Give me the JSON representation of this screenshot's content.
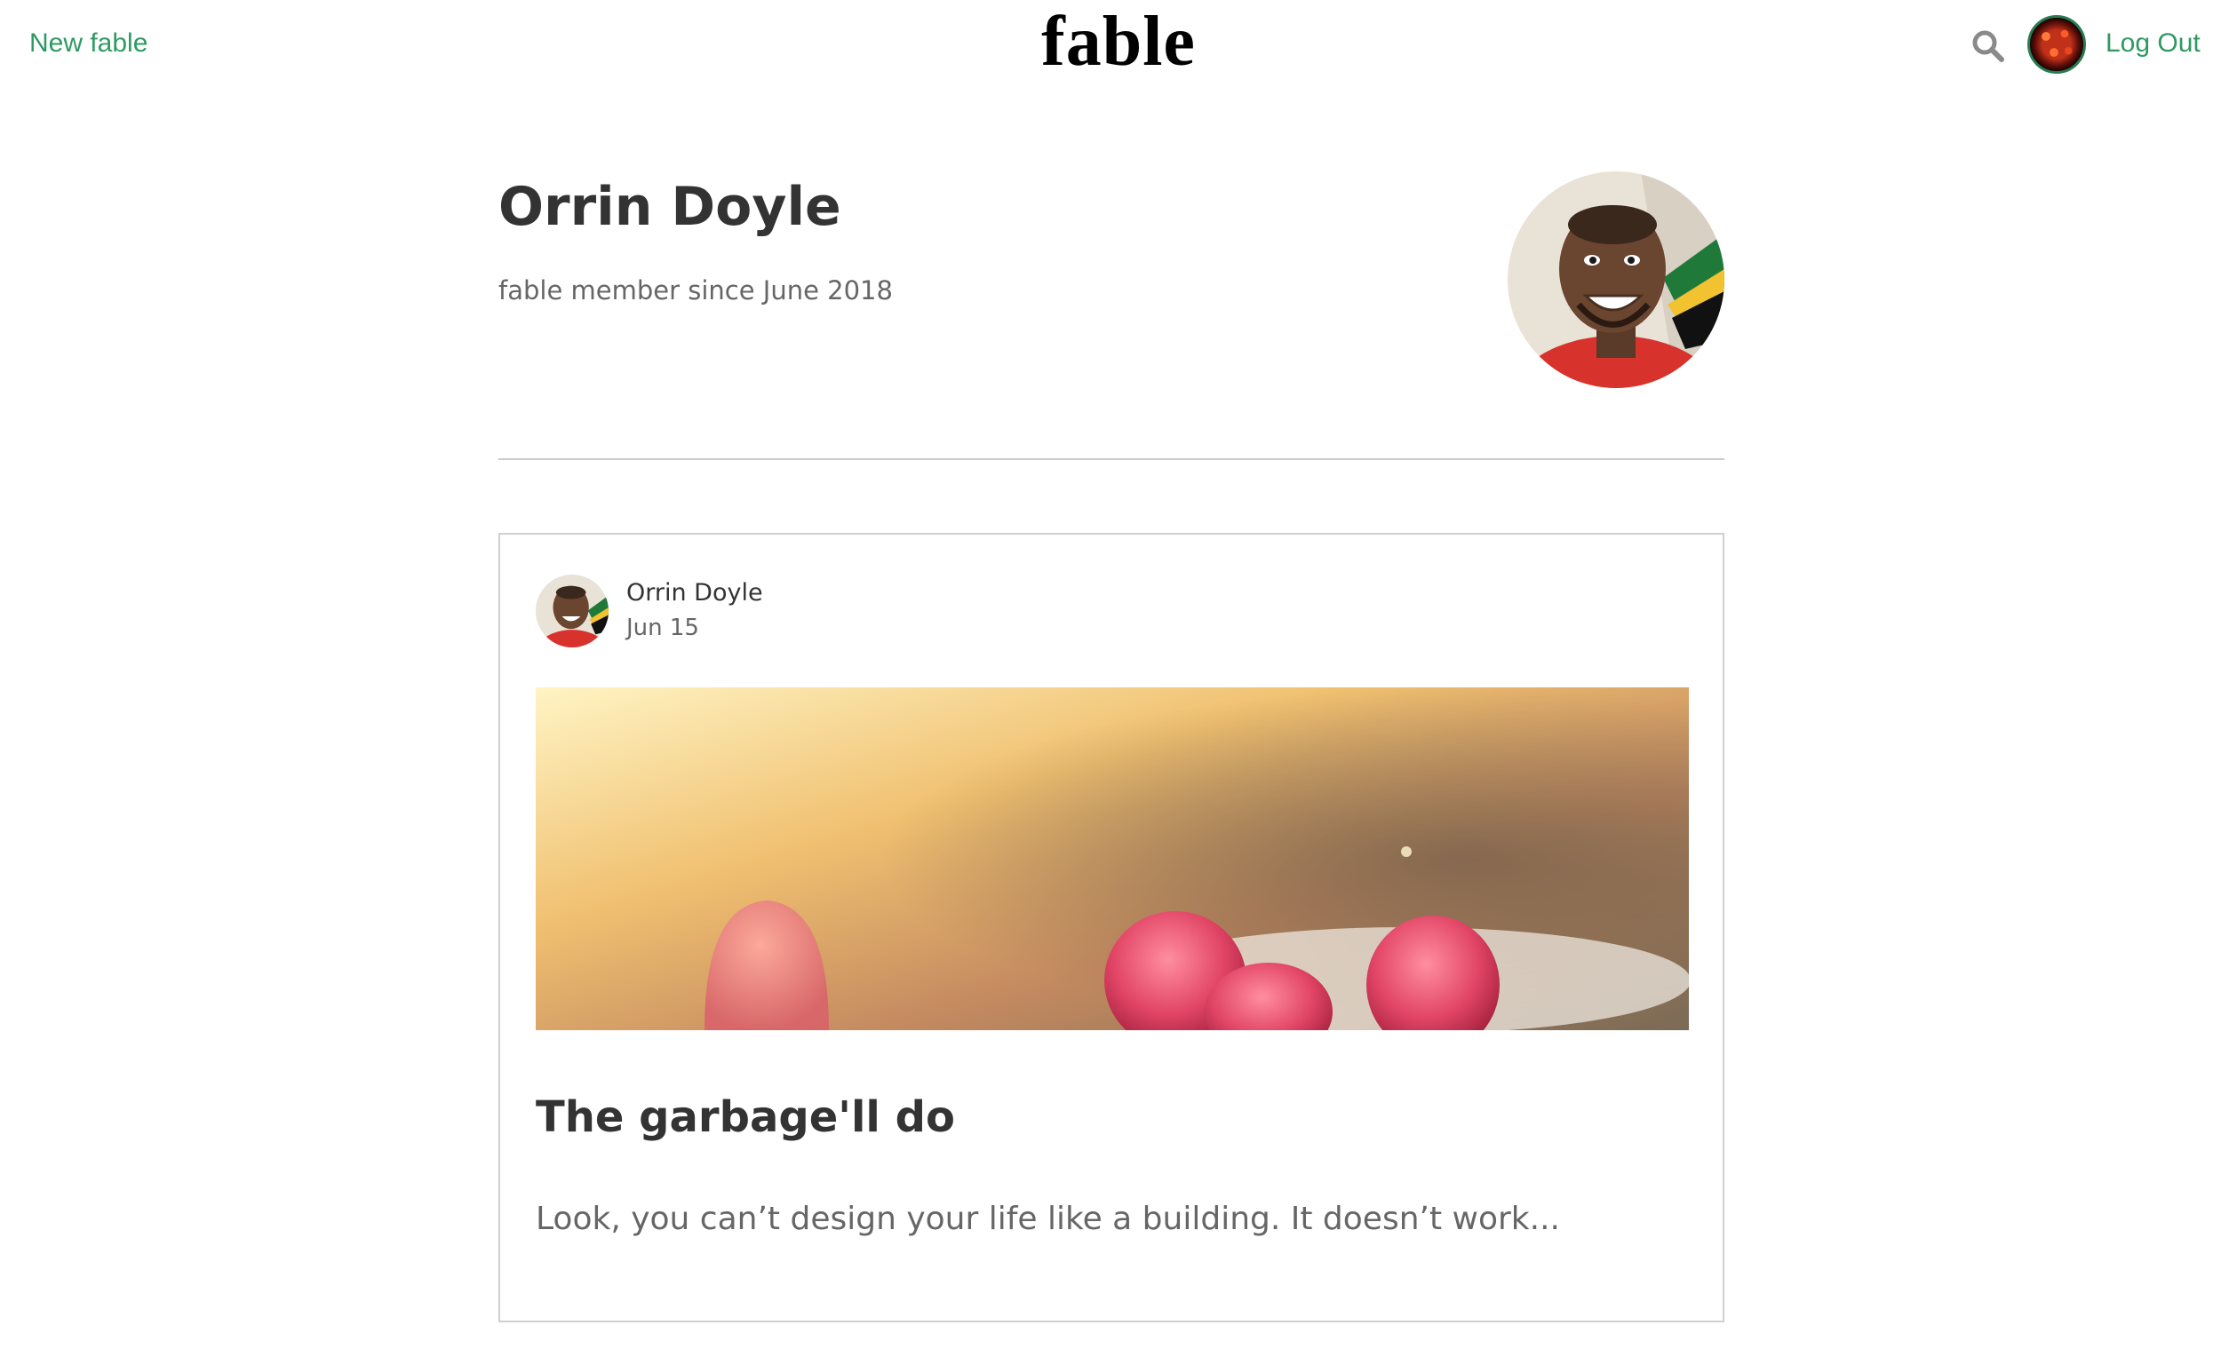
{
  "nav": {
    "new_label": "New fable",
    "logo": "fable",
    "logout_label": "Log Out",
    "accent_color": "#2e9a63",
    "icons": [
      "search-icon",
      "user-avatar"
    ]
  },
  "profile": {
    "name": "Orrin Doyle",
    "member_since": "fable member since June 2018"
  },
  "posts": [
    {
      "author": "Orrin Doyle",
      "date": "Jun 15",
      "title": "The garbage'll do",
      "excerpt": "Look, you can’t design your life like a building. It doesn’t work..."
    }
  ]
}
